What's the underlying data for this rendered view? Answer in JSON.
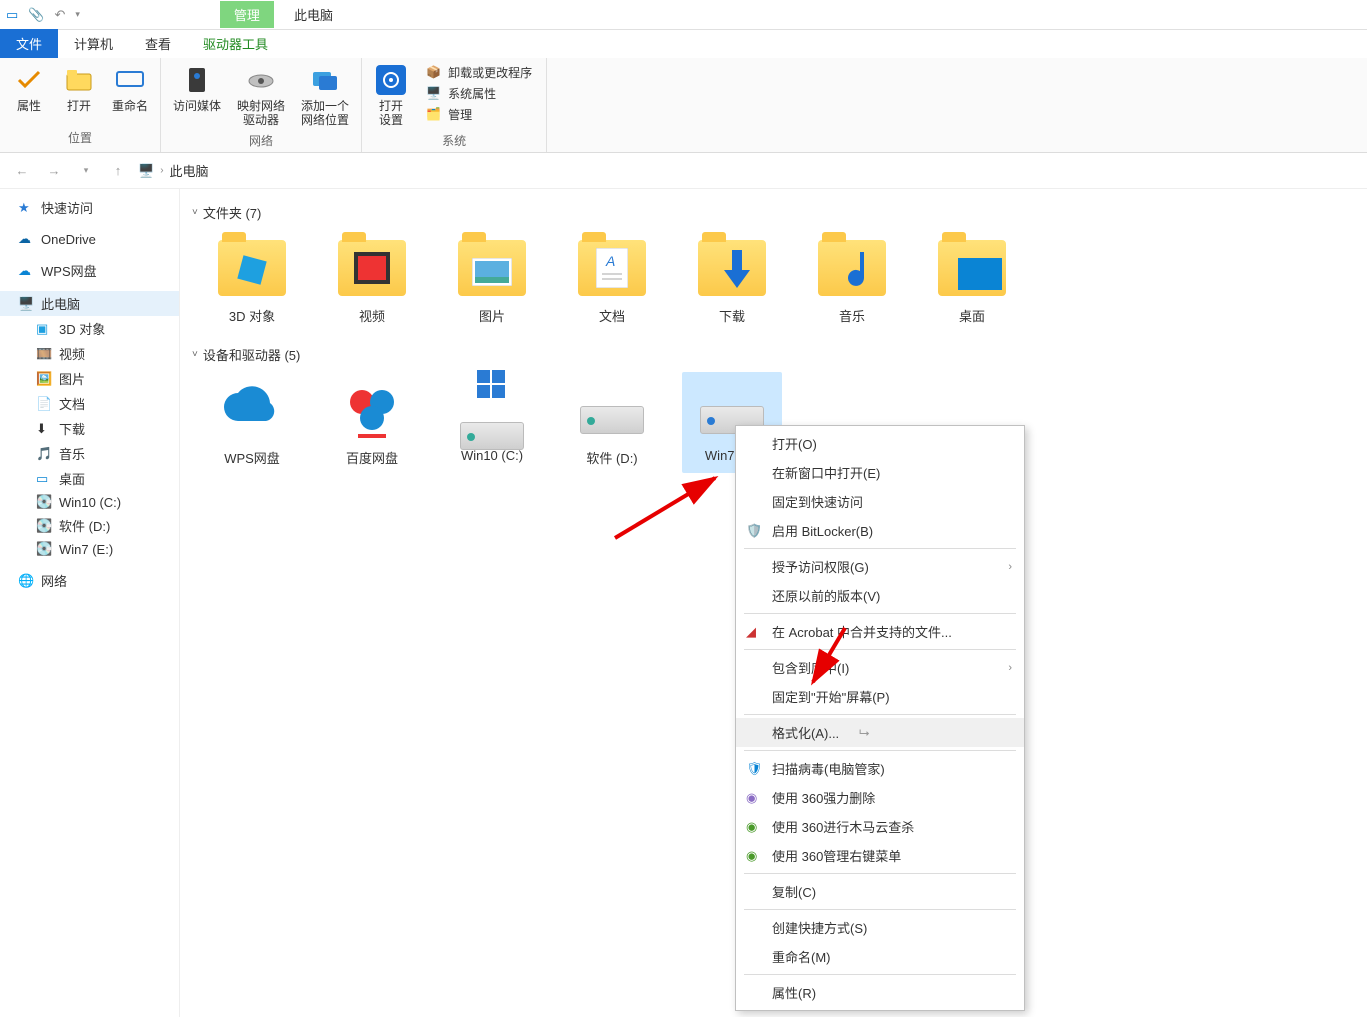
{
  "titlebar": {
    "manage": "管理",
    "title": "此电脑"
  },
  "tabs": {
    "file": "文件",
    "computer": "计算机",
    "view": "查看",
    "drive_tools": "驱动器工具"
  },
  "ribbon": {
    "location": {
      "label": "位置",
      "properties": "属性",
      "open": "打开",
      "rename": "重命名"
    },
    "network": {
      "label": "网络",
      "access_media": "访问媒体",
      "map_drive": "映射网络\n驱动器",
      "add_location": "添加一个\n网络位置"
    },
    "system": {
      "label": "系统",
      "open_settings": "打开\n设置",
      "uninstall": "卸载或更改程序",
      "sys_props": "系统属性",
      "manage": "管理"
    }
  },
  "breadcrumb": {
    "this_pc": "此电脑"
  },
  "sidebar": {
    "quick_access": "快速访问",
    "onedrive": "OneDrive",
    "wps": "WPS网盘",
    "this_pc": "此电脑",
    "objects_3d": "3D 对象",
    "videos": "视频",
    "pictures": "图片",
    "documents": "文档",
    "downloads": "下载",
    "music": "音乐",
    "desktop": "桌面",
    "win10": "Win10 (C:)",
    "software": "软件 (D:)",
    "win7": "Win7 (E:)",
    "network": "网络"
  },
  "groups": {
    "folders": "文件夹 (7)",
    "devices": "设备和驱动器 (5)"
  },
  "folders": [
    {
      "name": "3D 对象"
    },
    {
      "name": "视频"
    },
    {
      "name": "图片"
    },
    {
      "name": "文档"
    },
    {
      "name": "下载"
    },
    {
      "name": "音乐"
    },
    {
      "name": "桌面"
    }
  ],
  "drives": [
    {
      "name": "WPS网盘"
    },
    {
      "name": "百度网盘"
    },
    {
      "name": "Win10 (C:)"
    },
    {
      "name": "软件 (D:)"
    },
    {
      "name": "Win7 (E:)"
    }
  ],
  "context_menu": {
    "open": "打开(O)",
    "open_new_window": "在新窗口中打开(E)",
    "pin_quick": "固定到快速访问",
    "bitlocker": "启用 BitLocker(B)",
    "grant_access": "授予访问权限(G)",
    "restore_prev": "还原以前的版本(V)",
    "acrobat": "在 Acrobat 中合并支持的文件...",
    "include_lib": "包含到库中(I)",
    "pin_start": "固定到\"开始\"屏幕(P)",
    "format": "格式化(A)...",
    "scan_virus": "扫描病毒(电脑管家)",
    "360_shred": "使用 360强力删除",
    "360_trojan": "使用 360进行木马云查杀",
    "360_menu": "使用 360管理右键菜单",
    "copy": "复制(C)",
    "create_shortcut": "创建快捷方式(S)",
    "rename": "重命名(M)",
    "properties": "属性(R)"
  }
}
